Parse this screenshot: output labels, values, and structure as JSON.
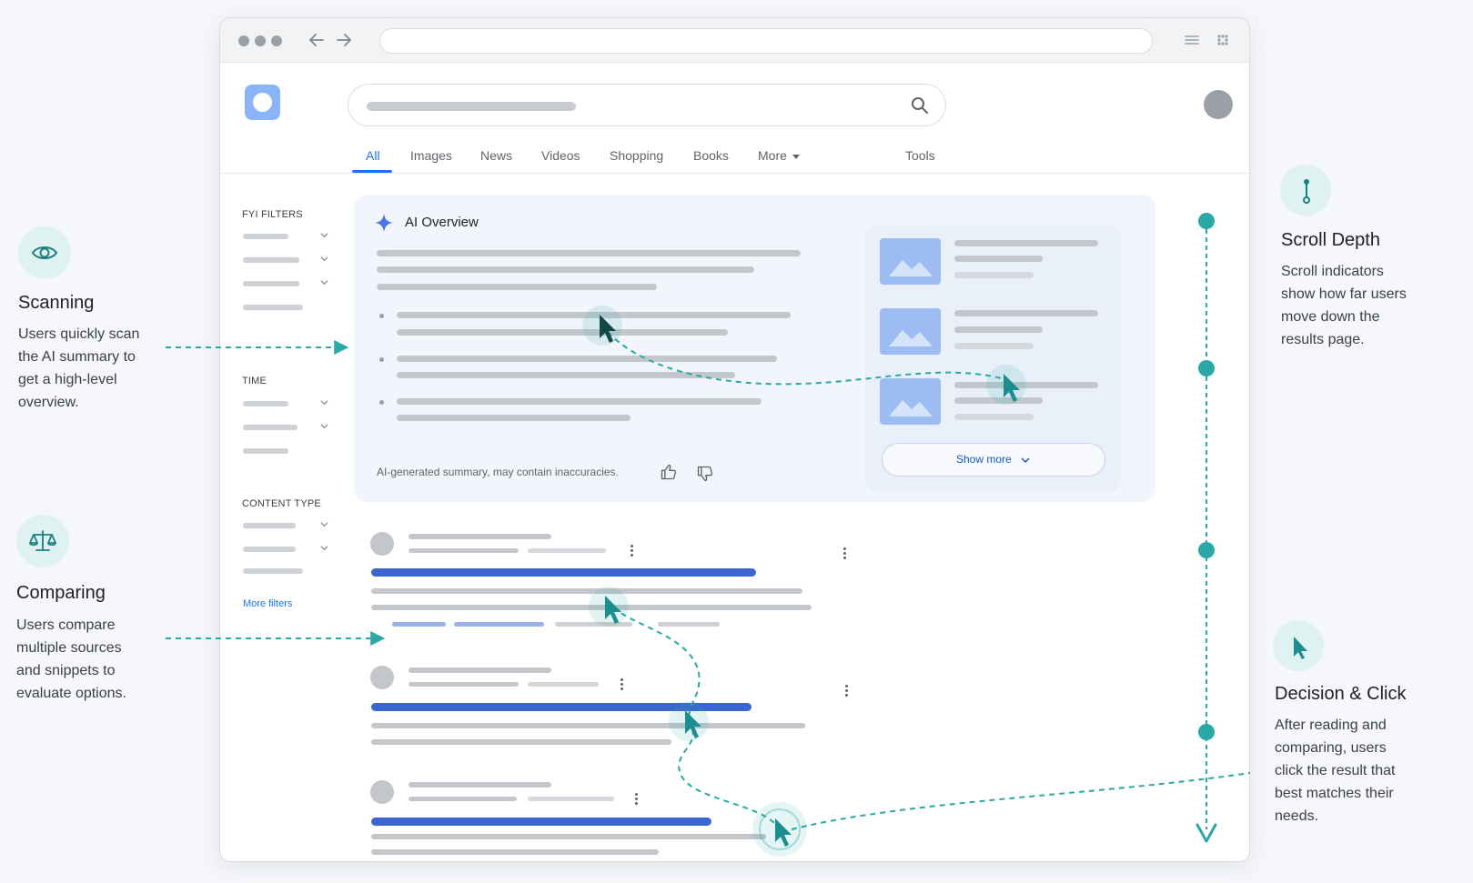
{
  "serp": {
    "tabs": [
      "All",
      "Images",
      "News",
      "Videos",
      "Shopping",
      "Books",
      "More"
    ],
    "tools_label": "Tools",
    "filters": {
      "fyi_title": "FYI FILTERS",
      "time_title": "TIME",
      "content_type_title": "CONTENT TYPE",
      "more_filters": "More filters"
    },
    "ai_overview": {
      "title": "AI Overview",
      "disclaimer": "AI-generated summary, may contain inaccuracies.",
      "show_more": "Show more"
    }
  },
  "annotations": {
    "scanning": {
      "title": "Scanning",
      "body": [
        "Users quickly scan",
        "the AI summary to",
        "get a high-level",
        "overview."
      ]
    },
    "comparing": {
      "title": "Comparing",
      "body": [
        "Users compare",
        "multiple sources",
        "and snippets to",
        "evaluate options."
      ]
    },
    "scroll_depth": {
      "title": "Scroll Depth",
      "body": [
        "Scroll indicators",
        "show how far users",
        "move down the",
        "results page."
      ]
    },
    "decision": {
      "title": "Decision & Click",
      "body": [
        "After reading and",
        "comparing, users",
        "click the result that",
        "best matches their",
        "needs."
      ]
    }
  },
  "colors": {
    "teal": "#2aa7a7",
    "teal_dark": "#1d7f80",
    "google_blue": "#1a73e8",
    "result_title_blue": "#3a66cf"
  },
  "icons": [
    "eye-icon",
    "scale-icon",
    "scroll-marker-icon",
    "cursor-icon",
    "search-icon",
    "sparkle-icon",
    "thumbs-up-icon",
    "thumbs-down-icon"
  ]
}
